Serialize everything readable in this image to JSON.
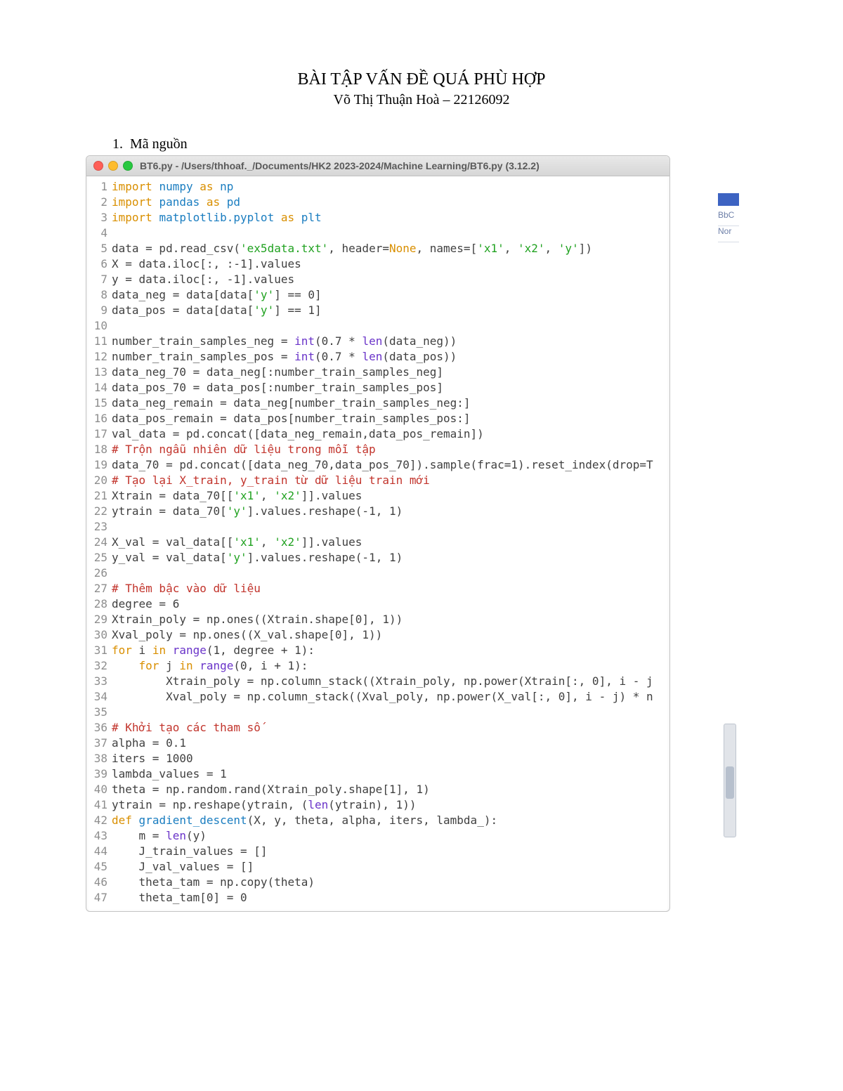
{
  "doc": {
    "title": "BÀI TẬP VẤN ĐỀ QUÁ PHÙ HỢP",
    "author": "Võ Thị Thuận Hoà – 22126092",
    "section_index": "1.",
    "section_label": "Mã nguồn"
  },
  "window": {
    "title": "BT6.py - /Users/thhoaf._/Documents/HK2 2023-2024/Machine Learning/BT6.py (3.12.2)"
  },
  "bg": {
    "label1": "BbC",
    "label2": "Nor"
  },
  "code_lines": [
    {
      "n": 1,
      "tokens": [
        [
          "k",
          "import"
        ],
        [
          "n",
          " "
        ],
        [
          "m",
          "numpy"
        ],
        [
          "n",
          " "
        ],
        [
          "k",
          "as"
        ],
        [
          "n",
          " "
        ],
        [
          "m",
          "np"
        ]
      ]
    },
    {
      "n": 2,
      "tokens": [
        [
          "k",
          "import"
        ],
        [
          "n",
          " "
        ],
        [
          "m",
          "pandas"
        ],
        [
          "n",
          " "
        ],
        [
          "k",
          "as"
        ],
        [
          "n",
          " "
        ],
        [
          "m",
          "pd"
        ]
      ]
    },
    {
      "n": 3,
      "tokens": [
        [
          "k",
          "import"
        ],
        [
          "n",
          " "
        ],
        [
          "m",
          "matplotlib.pyplot"
        ],
        [
          "n",
          " "
        ],
        [
          "k",
          "as"
        ],
        [
          "n",
          " "
        ],
        [
          "m",
          "plt"
        ]
      ]
    },
    {
      "n": 4,
      "tokens": []
    },
    {
      "n": 5,
      "tokens": [
        [
          "n",
          "data = pd.read_csv("
        ],
        [
          "s",
          "'ex5data.txt'"
        ],
        [
          "n",
          ", header="
        ],
        [
          "kw",
          "None"
        ],
        [
          "n",
          ", names=["
        ],
        [
          "s",
          "'x1'"
        ],
        [
          "n",
          ", "
        ],
        [
          "s",
          "'x2'"
        ],
        [
          "n",
          ", "
        ],
        [
          "s",
          "'y'"
        ],
        [
          "n",
          "])"
        ]
      ]
    },
    {
      "n": 6,
      "tokens": [
        [
          "n",
          "X = data.iloc[:, :-1].values"
        ]
      ]
    },
    {
      "n": 7,
      "tokens": [
        [
          "n",
          "y = data.iloc[:, -1].values"
        ]
      ]
    },
    {
      "n": 8,
      "tokens": [
        [
          "n",
          "data_neg = data[data["
        ],
        [
          "s",
          "'y'"
        ],
        [
          "n",
          "] == 0]"
        ]
      ]
    },
    {
      "n": 9,
      "tokens": [
        [
          "n",
          "data_pos = data[data["
        ],
        [
          "s",
          "'y'"
        ],
        [
          "n",
          "] == 1]"
        ]
      ]
    },
    {
      "n": 10,
      "tokens": []
    },
    {
      "n": 11,
      "tokens": [
        [
          "n",
          "number_train_samples_neg = "
        ],
        [
          "fn",
          "int"
        ],
        [
          "n",
          "(0.7 * "
        ],
        [
          "fn",
          "len"
        ],
        [
          "n",
          "(data_neg))"
        ]
      ]
    },
    {
      "n": 12,
      "tokens": [
        [
          "n",
          "number_train_samples_pos = "
        ],
        [
          "fn",
          "int"
        ],
        [
          "n",
          "(0.7 * "
        ],
        [
          "fn",
          "len"
        ],
        [
          "n",
          "(data_pos))"
        ]
      ]
    },
    {
      "n": 13,
      "tokens": [
        [
          "n",
          "data_neg_70 = data_neg[:number_train_samples_neg]"
        ]
      ]
    },
    {
      "n": 14,
      "tokens": [
        [
          "n",
          "data_pos_70 = data_pos[:number_train_samples_pos]"
        ]
      ]
    },
    {
      "n": 15,
      "tokens": [
        [
          "n",
          "data_neg_remain = data_neg[number_train_samples_neg:]"
        ]
      ]
    },
    {
      "n": 16,
      "tokens": [
        [
          "n",
          "data_pos_remain = data_pos[number_train_samples_pos:]"
        ]
      ]
    },
    {
      "n": 17,
      "tokens": [
        [
          "n",
          "val_data = pd.concat([data_neg_remain,data_pos_remain])"
        ]
      ]
    },
    {
      "n": 18,
      "tokens": [
        [
          "c",
          "# Trộn ngẫu nhiên dữ liệu trong mỗi tập"
        ]
      ]
    },
    {
      "n": 19,
      "tokens": [
        [
          "n",
          "data_70 = pd.concat([data_neg_70,data_pos_70]).sample(frac=1).reset_index(drop=T"
        ]
      ]
    },
    {
      "n": 20,
      "tokens": [
        [
          "c",
          "# Tạo lại X_train, y_train từ dữ liệu train mới"
        ]
      ]
    },
    {
      "n": 21,
      "tokens": [
        [
          "n",
          "Xtrain = data_70[["
        ],
        [
          "s",
          "'x1'"
        ],
        [
          "n",
          ", "
        ],
        [
          "s",
          "'x2'"
        ],
        [
          "n",
          "]].values"
        ]
      ]
    },
    {
      "n": 22,
      "tokens": [
        [
          "n",
          "ytrain = data_70["
        ],
        [
          "s",
          "'y'"
        ],
        [
          "n",
          "].values.reshape(-1, 1)"
        ]
      ]
    },
    {
      "n": 23,
      "tokens": []
    },
    {
      "n": 24,
      "tokens": [
        [
          "n",
          "X_val = val_data[["
        ],
        [
          "s",
          "'x1'"
        ],
        [
          "n",
          ", "
        ],
        [
          "s",
          "'x2'"
        ],
        [
          "n",
          "]].values"
        ]
      ]
    },
    {
      "n": 25,
      "tokens": [
        [
          "n",
          "y_val = val_data["
        ],
        [
          "s",
          "'y'"
        ],
        [
          "n",
          "].values.reshape(-1, 1)"
        ]
      ]
    },
    {
      "n": 26,
      "tokens": []
    },
    {
      "n": 27,
      "tokens": [
        [
          "c",
          "# Thêm bậc vào dữ liệu"
        ]
      ]
    },
    {
      "n": 28,
      "tokens": [
        [
          "n",
          "degree = 6"
        ]
      ]
    },
    {
      "n": 29,
      "tokens": [
        [
          "n",
          "Xtrain_poly = np.ones((Xtrain.shape[0], 1))"
        ]
      ]
    },
    {
      "n": 30,
      "tokens": [
        [
          "n",
          "Xval_poly = np.ones((X_val.shape[0], 1))"
        ]
      ]
    },
    {
      "n": 31,
      "tokens": [
        [
          "k",
          "for"
        ],
        [
          "n",
          " i "
        ],
        [
          "k",
          "in"
        ],
        [
          "n",
          " "
        ],
        [
          "fn",
          "range"
        ],
        [
          "n",
          "(1, degree + 1):"
        ]
      ]
    },
    {
      "n": 32,
      "tokens": [
        [
          "n",
          "    "
        ],
        [
          "k",
          "for"
        ],
        [
          "n",
          " j "
        ],
        [
          "k",
          "in"
        ],
        [
          "n",
          " "
        ],
        [
          "fn",
          "range"
        ],
        [
          "n",
          "(0, i + 1):"
        ]
      ]
    },
    {
      "n": 33,
      "tokens": [
        [
          "n",
          "        Xtrain_poly = np.column_stack((Xtrain_poly, np.power(Xtrain[:, 0], i - j"
        ]
      ]
    },
    {
      "n": 34,
      "tokens": [
        [
          "n",
          "        Xval_poly = np.column_stack((Xval_poly, np.power(X_val[:, 0], i - j) * n"
        ]
      ]
    },
    {
      "n": 35,
      "tokens": []
    },
    {
      "n": 36,
      "tokens": [
        [
          "c",
          "# Khởi tạo các tham số"
        ]
      ]
    },
    {
      "n": 37,
      "tokens": [
        [
          "n",
          "alpha = 0.1"
        ]
      ]
    },
    {
      "n": 38,
      "tokens": [
        [
          "n",
          "iters = 1000"
        ]
      ]
    },
    {
      "n": 39,
      "tokens": [
        [
          "n",
          "lambda_values = 1"
        ]
      ]
    },
    {
      "n": 40,
      "tokens": [
        [
          "n",
          "theta = np.random.rand(Xtrain_poly.shape[1], 1)"
        ]
      ]
    },
    {
      "n": 41,
      "tokens": [
        [
          "n",
          "ytrain = np.reshape(ytrain, ("
        ],
        [
          "fn",
          "len"
        ],
        [
          "n",
          "(ytrain), 1))"
        ]
      ]
    },
    {
      "n": 42,
      "tokens": [
        [
          "k",
          "def"
        ],
        [
          "n",
          " "
        ],
        [
          "m",
          "gradient_descent"
        ],
        [
          "n",
          "(X, y, theta, alpha, iters, lambda_):"
        ]
      ]
    },
    {
      "n": 43,
      "tokens": [
        [
          "n",
          "    m = "
        ],
        [
          "fn",
          "len"
        ],
        [
          "n",
          "(y)"
        ]
      ]
    },
    {
      "n": 44,
      "tokens": [
        [
          "n",
          "    J_train_values = []"
        ]
      ]
    },
    {
      "n": 45,
      "tokens": [
        [
          "n",
          "    J_val_values = []"
        ]
      ]
    },
    {
      "n": 46,
      "tokens": [
        [
          "n",
          "    theta_tam = np.copy(theta)"
        ]
      ]
    },
    {
      "n": 47,
      "tokens": [
        [
          "n",
          "    theta_tam[0] = 0"
        ]
      ]
    }
  ]
}
